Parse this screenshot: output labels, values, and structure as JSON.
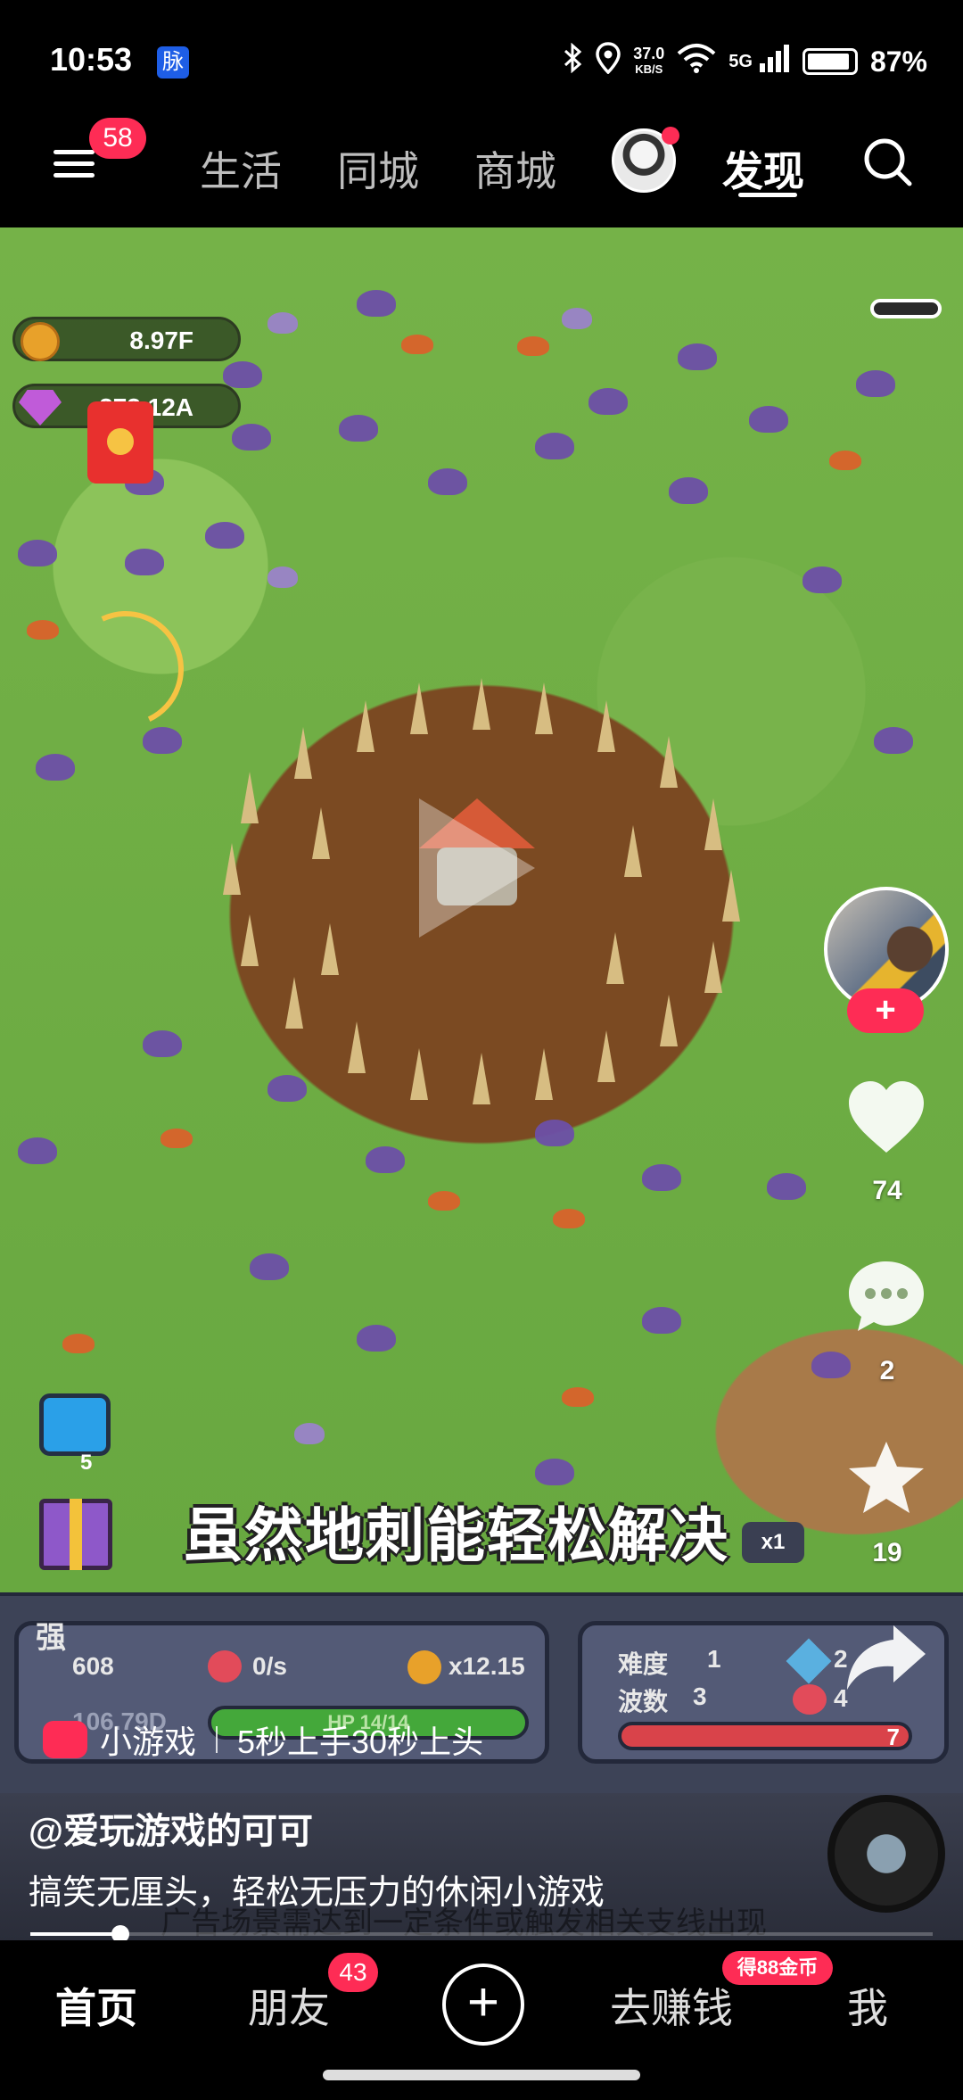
{
  "status_bar": {
    "time": "10:53",
    "app_badge": "脉",
    "net_speed_value": "37.0",
    "net_speed_unit": "KB/S",
    "network": "5G",
    "battery": "87%"
  },
  "top_nav": {
    "menu_badge": "58",
    "tabs": [
      "生活",
      "同城",
      "商城",
      "发现"
    ],
    "active_tab": "发现"
  },
  "game_hud": {
    "coins": "8.97F",
    "gems": "273.12A",
    "tv_count": "5",
    "caption": "虽然地刺能轻松解决",
    "speed": "x1",
    "stat_1": "608",
    "stat_2": "0/s",
    "stat_3": "x12.15",
    "stat_4": "106.79D",
    "hp": "HP 14/14",
    "difficulty_label": "难度",
    "difficulty_value": "1",
    "wave_label": "波数",
    "wave_value": "3",
    "attack": "2",
    "defense": "4",
    "wave_bar_value": "7",
    "side_label": "强"
  },
  "right_rail": {
    "likes": "74",
    "comments": "2",
    "favorites": "19",
    "follow_symbol": "+"
  },
  "game_tag": {
    "label": "小游戏",
    "slogan": "5秒上手30秒上头"
  },
  "description": {
    "author": "@爱玩游戏的可可",
    "text": "搞笑无厘头，轻松无压力的休闲小游戏",
    "sub_caption": "广告场景需达到一定条件或触发相关支线出现"
  },
  "video_progress": 0.1,
  "bottom_nav": {
    "home": "首页",
    "friends": "朋友",
    "friends_badge": "43",
    "add": "+",
    "earn": "去赚钱",
    "earn_badge": "得88金币",
    "me": "我"
  },
  "colors": {
    "accent": "#fe2c55",
    "background": "#000000"
  }
}
